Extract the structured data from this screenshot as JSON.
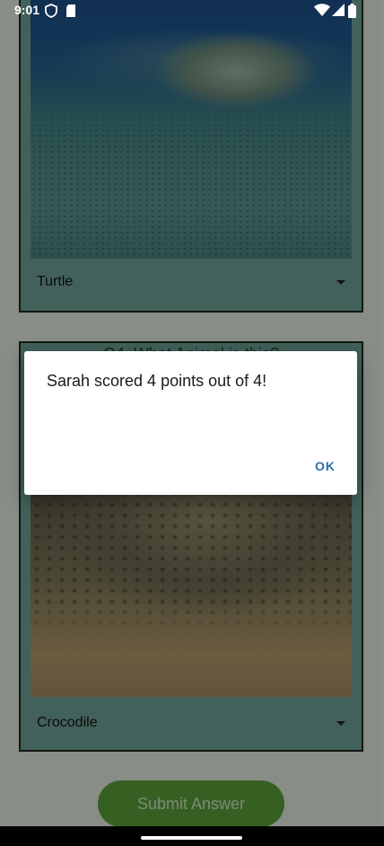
{
  "status_bar": {
    "time": "9:01"
  },
  "quiz": {
    "card_1": {
      "image_alt_icon": "turtle-photo",
      "selected_answer": "Turtle"
    },
    "card_2": {
      "question": "Q4. What Animal is this?",
      "image_alt_icon": "crocodile-photo",
      "selected_answer": "Crocodile"
    },
    "submit_label": "Submit Answer"
  },
  "dialog": {
    "message": "Sarah scored 4 points out of 4!",
    "ok_label": "OK"
  },
  "colors": {
    "accent_button": "#5aa03a",
    "dialog_button_text": "#2f6fa8",
    "card_border": "#1e2b1d"
  }
}
